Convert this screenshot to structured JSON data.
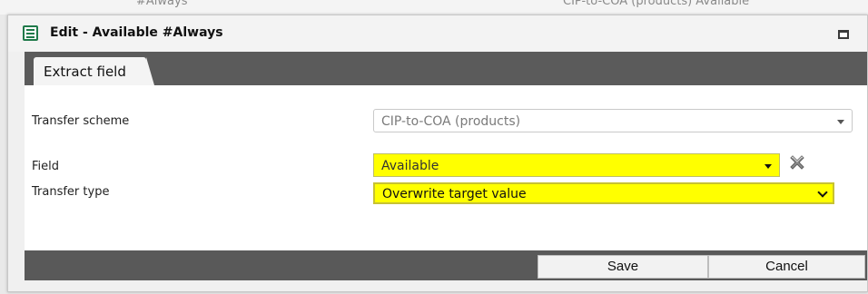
{
  "background": {
    "left_text": "#Always",
    "right_text": "CIP-to-COA (products)  Available"
  },
  "dialog": {
    "title": "Edit - Available #Always",
    "icon": "form-icon",
    "maximize_icon": "maximize-icon"
  },
  "tabs": [
    {
      "label": "Extract field",
      "active": true
    }
  ],
  "form": {
    "transfer_scheme": {
      "label": "Transfer scheme",
      "value": "CIP-to-COA (products)",
      "state": "disabled"
    },
    "field": {
      "label": "Field",
      "value": "Available",
      "highlight": "#ffff00",
      "clear_icon": "clear-x-icon"
    },
    "transfer_type": {
      "label": "Transfer type",
      "value": "Overwrite target value",
      "highlight": "#ffff00"
    }
  },
  "footer": {
    "save_label": "Save",
    "cancel_label": "Cancel"
  },
  "colors": {
    "header_bar": "#5b5b5b",
    "highlight": "#ffff00",
    "title_icon": "#207a4a"
  }
}
